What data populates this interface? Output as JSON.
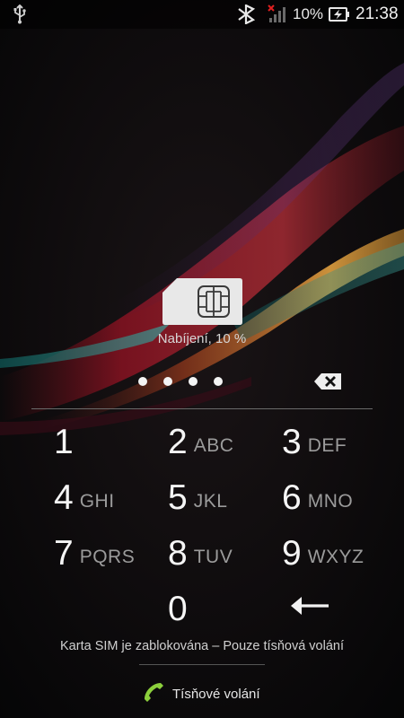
{
  "status_bar": {
    "battery_percent": "10%",
    "time": "21:38",
    "icons": [
      "usb-icon",
      "bluetooth-icon",
      "no-signal-icon",
      "battery-charging-icon"
    ]
  },
  "sim": {
    "icon": "sim-card-icon",
    "charging_text": "Nabíjení, 10 %"
  },
  "pin": {
    "entered_digits": 4,
    "delete_icon": "backspace-icon"
  },
  "keypad": {
    "keys": [
      {
        "digit": "1",
        "letters": ""
      },
      {
        "digit": "2",
        "letters": "ABC"
      },
      {
        "digit": "3",
        "letters": "DEF"
      },
      {
        "digit": "4",
        "letters": "GHI"
      },
      {
        "digit": "5",
        "letters": "JKL"
      },
      {
        "digit": "6",
        "letters": "MNO"
      },
      {
        "digit": "7",
        "letters": "PQRS"
      },
      {
        "digit": "8",
        "letters": "TUV"
      },
      {
        "digit": "9",
        "letters": "WXYZ"
      },
      {
        "digit": "0",
        "letters": ""
      }
    ],
    "enter_icon": "enter-arrow-icon"
  },
  "footer": {
    "sim_locked_text": "Karta SIM je zablokována – Pouze tísňová volání",
    "emergency_label": "Tísňové volání",
    "emergency_icon": "phone-handset-icon"
  },
  "colors": {
    "background": "#0b0b0c",
    "emergency_green": "#8ccf3c"
  }
}
